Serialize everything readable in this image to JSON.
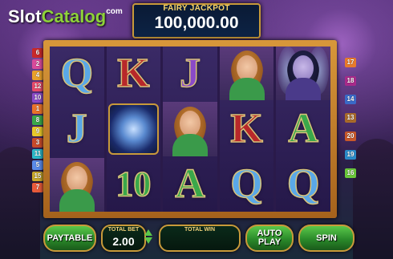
{
  "logo": {
    "part1": "Slot",
    "part2": "Catalog",
    "suffix": "com"
  },
  "jackpot": {
    "title": "FAIRY JACKPOT",
    "value": "100,000.00"
  },
  "paylines_left": [
    "6",
    "2",
    "4",
    "12",
    "10",
    "1",
    "8",
    "9",
    "3",
    "11",
    "5",
    "15",
    "7"
  ],
  "paylines_right": [
    "17",
    "18",
    "14",
    "13",
    "20",
    "19",
    "16"
  ],
  "payline_colors": [
    "#e8732a",
    "#d84a9a",
    "#c84a2a",
    "#e8a02a",
    "#5a8ae8",
    "#c8282a",
    "#e85a3a",
    "#3aa84a",
    "#e8c82a",
    "#8a4ac8",
    "#2ab8c8",
    "#e84a6a",
    "#a86a2a",
    "#3a6ac8",
    "#c8a82a",
    "#6ac83a",
    "#e87a2a",
    "#a82a8a",
    "#2a8ac8",
    "#c8582a"
  ],
  "reels": [
    [
      {
        "type": "letter",
        "text": "Q",
        "color": "blue"
      },
      {
        "type": "letter",
        "text": "J",
        "color": "blue"
      },
      {
        "type": "fairy",
        "variant": "gold"
      }
    ],
    [
      {
        "type": "letter",
        "text": "K",
        "color": "red"
      },
      {
        "type": "moon",
        "icon": "moon-scatter-icon"
      },
      {
        "type": "letter",
        "text": "10",
        "color": "green"
      }
    ],
    [
      {
        "type": "letter",
        "text": "J",
        "color": "purple"
      },
      {
        "type": "fairy",
        "variant": "gold"
      },
      {
        "type": "letter",
        "text": "A",
        "color": "green"
      }
    ],
    [
      {
        "type": "fairy",
        "variant": "gold"
      },
      {
        "type": "letter",
        "text": "K",
        "color": "red"
      },
      {
        "type": "letter",
        "text": "Q",
        "color": "blue"
      }
    ],
    [
      {
        "type": "fairy",
        "variant": "dark"
      },
      {
        "type": "letter",
        "text": "A",
        "color": "green"
      },
      {
        "type": "letter",
        "text": "Q",
        "color": "blue"
      }
    ]
  ],
  "controls": {
    "paytable_label": "PAYTABLE",
    "total_bet_label": "TOTAL BET",
    "total_bet_value": "2.00",
    "total_win_label": "TOTAL WIN",
    "total_win_value": "",
    "autoplay_label": "AUTO PLAY",
    "spin_label": "SPIN"
  }
}
